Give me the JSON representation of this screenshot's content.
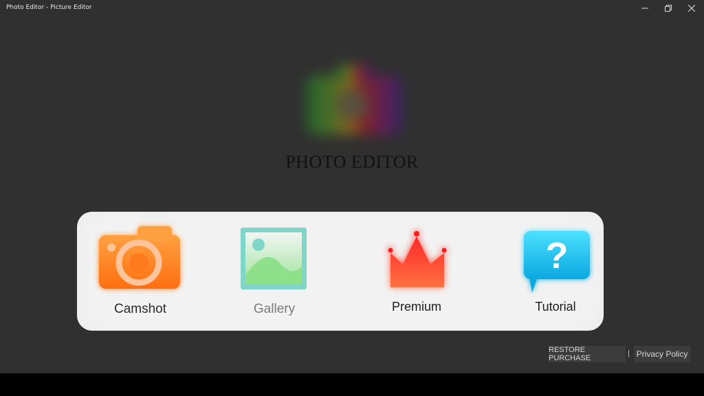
{
  "window": {
    "title": "Photo Editor - Picture Editor",
    "controls": [
      "minimize-icon",
      "restore-icon",
      "close-icon"
    ]
  },
  "hero": {
    "title": "PHOTO EDITOR"
  },
  "actions": [
    {
      "label": "Camshot",
      "icon": "camera-icon",
      "color": "#ff7a1a"
    },
    {
      "label": "Gallery",
      "icon": "gallery-icon",
      "color": "#7fd6c8"
    },
    {
      "label": "Premium",
      "icon": "crown-icon",
      "color": "#ff4a2a"
    },
    {
      "label": "Tutorial",
      "icon": "help-bubble-icon",
      "color": "#19c8f0"
    }
  ],
  "footer": {
    "restore_purchase": "RESTORE PURCHASE",
    "separator": "|",
    "privacy_policy": "Privacy Policy"
  },
  "colors": {
    "window_bg": "#303030",
    "panel_bg": "#f2f2f2",
    "title_dark": "#121212"
  }
}
